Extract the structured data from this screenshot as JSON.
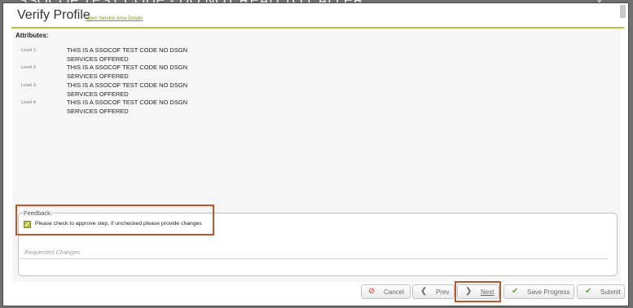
{
  "background_window": {
    "title": "SSOCOF TEST CODE - DO NOT READ TO CALLER",
    "close_glyph": "x"
  },
  "dialog": {
    "title": "Verify Profile",
    "service_area_link": "Open Service Area Details",
    "accent_color": "#b6c43e"
  },
  "attributes": {
    "heading": "Attributes:",
    "levels": [
      {
        "label": "Level 1:",
        "value_line1": "THIS IS A SSOCOF TEST CODE NO DSGN",
        "value_line2": "SERVICES OFFERED"
      },
      {
        "label": "Level 2:",
        "value_line1": "THIS IS A SSOCOF TEST CODE NO DSGN",
        "value_line2": "SERVICES OFFERED"
      },
      {
        "label": "Level 3:",
        "value_line1": "THIS IS A SSOCOF TEST CODE NO DSGN",
        "value_line2": "SERVICES OFFERED"
      },
      {
        "label": "Level 4:",
        "value_line1": "THIS IS A SSOCOF TEST CODE NO DSGN",
        "value_line2": "SERVICES OFFERED"
      }
    ]
  },
  "feedback": {
    "legend": "Feedback:",
    "approve_checked": true,
    "approve_label": "Please check to approve step, if unchecked please provide changes",
    "requested_changes_placeholder": "Requested Changes"
  },
  "footer": {
    "cancel": {
      "label": "Cancel",
      "icon": "cancel-circle-icon",
      "icon_glyph": "⊘",
      "icon_color": "#c8312f"
    },
    "prev": {
      "label": "Prev",
      "icon": "chevron-left-icon",
      "icon_glyph": "❮",
      "icon_color": "#666666"
    },
    "next": {
      "label": "Next",
      "icon": "chevron-right-icon",
      "icon_glyph": "❯",
      "icon_color": "#666666"
    },
    "save_progress": {
      "label": "Save Progress",
      "icon": "checkmark-icon",
      "icon_glyph": "✔",
      "icon_color": "#5aa53a"
    },
    "submit": {
      "label": "Submit",
      "icon": "checkmark-icon",
      "icon_glyph": "✔",
      "icon_color": "#5aa53a"
    }
  },
  "highlight_color": "#c0552f"
}
